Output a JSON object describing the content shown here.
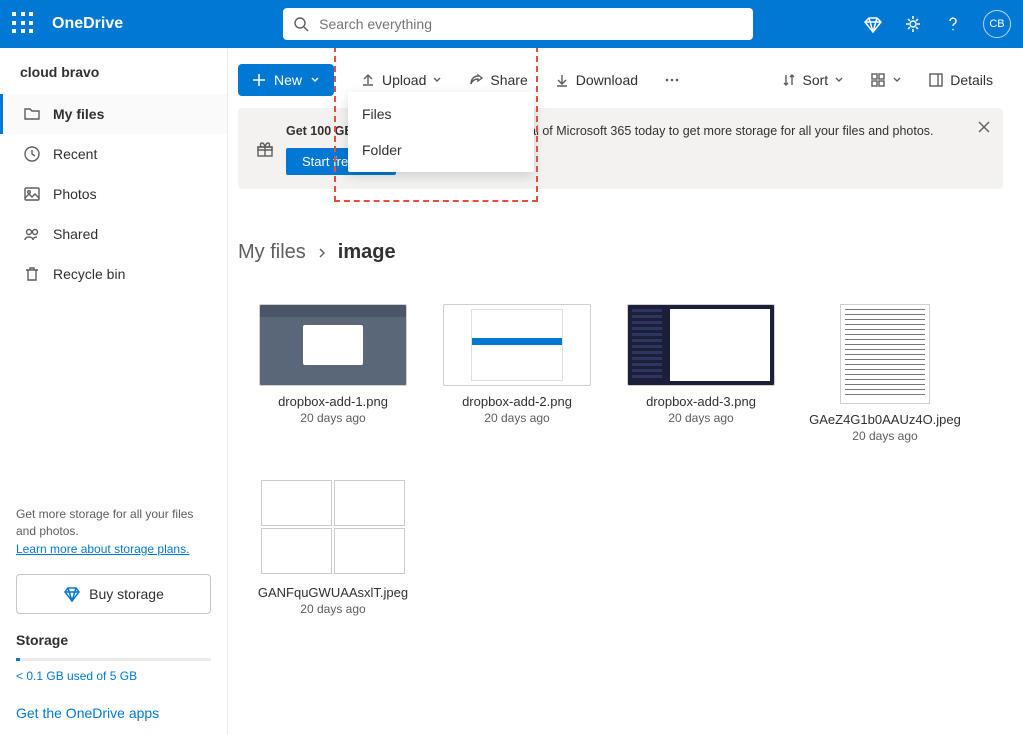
{
  "app": {
    "title": "OneDrive"
  },
  "search": {
    "placeholder": "Search everything"
  },
  "avatar": {
    "initials": "CB"
  },
  "sidebar": {
    "owner": "cloud bravo",
    "items": [
      {
        "label": "My files"
      },
      {
        "label": "Recent"
      },
      {
        "label": "Photos"
      },
      {
        "label": "Shared"
      },
      {
        "label": "Recycle bin"
      }
    ],
    "promo": "Get more storage for all your files and photos.",
    "promo_link": "Learn more about storage plans.",
    "buy": "Buy storage",
    "storage_head": "Storage",
    "storage_used": "< 0.1 GB used of 5 GB",
    "get_apps": "Get the OneDrive apps"
  },
  "toolbar": {
    "new": "New",
    "upload": "Upload",
    "share": "Share",
    "download": "Download",
    "sort": "Sort",
    "details": "Details"
  },
  "upload_menu": {
    "files": "Files",
    "folder": "Folder"
  },
  "promo": {
    "text_bold": "Get 100 GB free.",
    "text_rest": " Start your 1-month free trial of Microsoft 365 today to get more storage for all your files and photos.",
    "cta": "Start free trial"
  },
  "breadcrumb": {
    "root": "My files",
    "current": "image"
  },
  "files": [
    {
      "name": "dropbox-add-1.png",
      "time": "20 days ago"
    },
    {
      "name": "dropbox-add-2.png",
      "time": "20 days ago"
    },
    {
      "name": "dropbox-add-3.png",
      "time": "20 days ago"
    },
    {
      "name": "GAeZ4G1b0AAUz4O.jpeg",
      "time": "20 days ago"
    },
    {
      "name": "GANFquGWUAAsxlT.jpeg",
      "time": "20 days ago"
    }
  ]
}
